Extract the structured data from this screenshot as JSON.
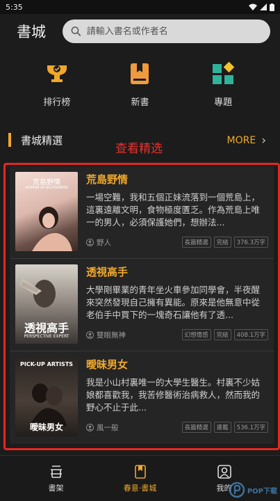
{
  "status": {
    "time": "5:35"
  },
  "header": {
    "title": "書城",
    "search_placeholder": "請輸入書名或作者名"
  },
  "quick_links": [
    {
      "label": "排行榜",
      "icon": "trophy-icon"
    },
    {
      "label": "新書",
      "icon": "bookmark-book-icon"
    },
    {
      "label": "專題",
      "icon": "grid-tiles-icon"
    }
  ],
  "section": {
    "title": "書城精選",
    "annotation": "查看精选",
    "more_label": "MORE"
  },
  "books": [
    {
      "title": "荒島野情",
      "synopsis": "一場空難，我和五個正妹流落到一個荒島上，這裏遠離文明，食物極度匱乏。作為荒島上唯一的男人，必須保護她們，想辦法...",
      "author": "野人",
      "tags": [
        "長篇精選",
        "完結",
        "376.3万字"
      ],
      "cover_title": "荒島野情",
      "cover_subtitle": "WOMAN IN WILDERNESS"
    },
    {
      "title": "透視高手",
      "synopsis": "大學剛畢業的青年坐火車參加同學會，半夜醒來突然發現自己擁有異能。原來是他無意中從老伯手中買下的一塊奇石讓他有了透...",
      "author": "雙眼無神",
      "tags": [
        "幻想情感",
        "完結",
        "408.1万字"
      ],
      "cover_title": "透視高手",
      "cover_subtitle": "PERSPECTIVE EXPERT"
    },
    {
      "title": "曖昧男女",
      "synopsis": "我是小山村裏唯一的大學生醫生。村裏不少姑娘都喜歡我，我苦修醫術治病救人，然而我的野心不止于此...",
      "author": "風一般",
      "tags": [
        "長篇精選",
        "連載",
        "536.1万字"
      ],
      "cover_title": "曖昧男女",
      "cover_subtitle": "PICK-UP ARTISTS"
    }
  ],
  "bottom_nav": [
    {
      "label": "書架",
      "icon": "bookshelf-icon"
    },
    {
      "label": "春意·書城",
      "icon": "book-store-icon",
      "active": true
    },
    {
      "label": "我的",
      "icon": "profile-icon"
    }
  ],
  "watermark": {
    "text": "POP下载"
  },
  "colors": {
    "accent": "#f0a82a",
    "highlight_border": "#e62720",
    "background": "#1c1c1c"
  }
}
